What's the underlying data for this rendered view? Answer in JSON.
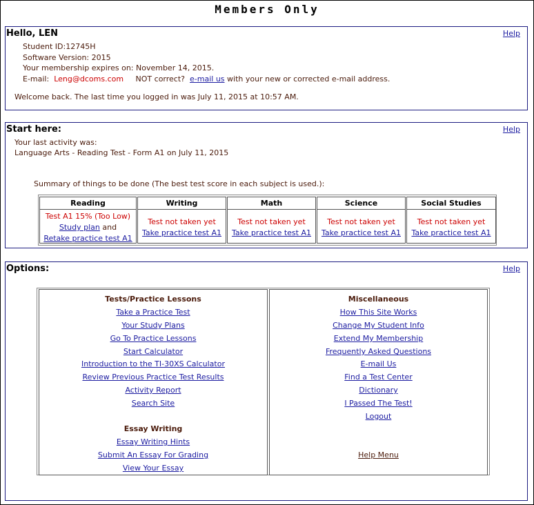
{
  "page": {
    "title": "Members Only"
  },
  "hello": {
    "greeting": "Hello, LEN",
    "help": "Help",
    "student_id": "Student ID:12745H",
    "software_version": "Software Version: 2015",
    "membership": "Your membership expires on: November 14, 2015.",
    "email_label": "E-mail:",
    "email_value": "Leng@dcoms.com",
    "not_correct": "NOT correct?",
    "email_us": "e-mail us",
    "email_suffix": "with your new or corrected e-mail address.",
    "welcome": "Welcome back. The last time you logged in was July 11, 2015 at 10:57 AM."
  },
  "start": {
    "heading": "Start here:",
    "help": "Help",
    "last_activity_label": "Your last activity was:",
    "last_activity": "Language Arts - Reading Test - Form A1 on July 11, 2015",
    "summary_caption": "Summary of things to be done (The best test score in each subject is used.):",
    "subjects": [
      {
        "name": "Reading",
        "status": "Test A1 15% (Too Low)",
        "link1": "Study plan",
        "and": "and",
        "link2": "Retake practice test A1"
      },
      {
        "name": "Writing",
        "status": "Test not taken yet",
        "link1": "Take practice test A1"
      },
      {
        "name": "Math",
        "status": "Test not taken yet",
        "link1": "Take practice test A1"
      },
      {
        "name": "Science",
        "status": "Test not taken yet",
        "link1": "Take practice test A1"
      },
      {
        "name": "Social Studies",
        "status": "Test not taken yet",
        "link1": "Take practice test A1"
      }
    ]
  },
  "options": {
    "heading": "Options:",
    "help": "Help",
    "tests_heading": "Tests/Practice Lessons",
    "tests_items": [
      "Take a Practice Test",
      "Your Study Plans",
      "Go To Practice Lessons",
      "Start Calculator",
      "Introduction to the TI-30XS Calculator",
      "Review Previous Practice Test Results",
      "Activity Report",
      "Search Site"
    ],
    "essay_heading": "Essay Writing",
    "essay_items": [
      "Essay Writing Hints",
      "Submit An Essay For Grading",
      "View Your Essay"
    ],
    "misc_heading": "Miscellaneous",
    "misc_items": [
      "How This Site Works",
      "Change My Student Info",
      "Extend My Membership",
      "Frequently Asked Questions",
      "E-mail Us",
      "Find a Test Center",
      "Dictionary",
      "I Passed The Test!",
      "Logout"
    ],
    "help_menu": "Help Menu"
  }
}
